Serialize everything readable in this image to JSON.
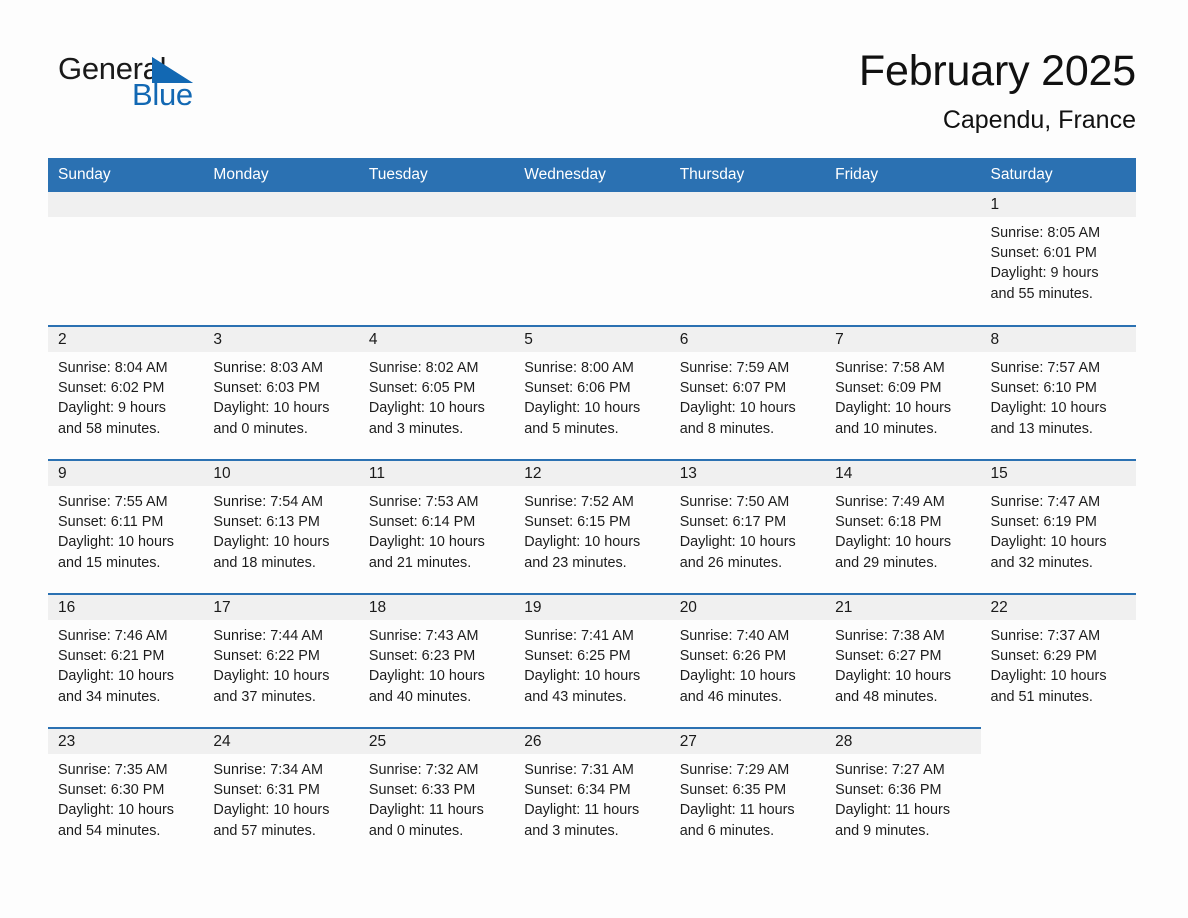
{
  "brand": {
    "name_part1": "General",
    "name_part2": "Blue",
    "accent_color": "#1268b3",
    "logo_icon": "triangle-flag-icon"
  },
  "header": {
    "month_title": "February 2025",
    "location": "Capendu, France"
  },
  "theme": {
    "header_blue": "#2b71b2",
    "row_rule_blue": "#2b71b2",
    "daynum_band": "#f0f0f0",
    "page_background": "#fdfdfd",
    "text": "#1d1d1d"
  },
  "weekday_headers": [
    "Sunday",
    "Monday",
    "Tuesday",
    "Wednesday",
    "Thursday",
    "Friday",
    "Saturday"
  ],
  "labels": {
    "sunrise_prefix": "Sunrise:",
    "sunset_prefix": "Sunset:",
    "daylight_prefix": "Daylight:"
  },
  "weeks": [
    [
      {
        "day": "",
        "blank": true
      },
      {
        "day": "",
        "blank": true
      },
      {
        "day": "",
        "blank": true
      },
      {
        "day": "",
        "blank": true
      },
      {
        "day": "",
        "blank": true
      },
      {
        "day": "",
        "blank": true
      },
      {
        "day": "1",
        "sunrise": "Sunrise: 8:05 AM",
        "sunset": "Sunset: 6:01 PM",
        "daylight_line1": "Daylight: 9 hours",
        "daylight_line2": "and 55 minutes."
      }
    ],
    [
      {
        "day": "2",
        "sunrise": "Sunrise: 8:04 AM",
        "sunset": "Sunset: 6:02 PM",
        "daylight_line1": "Daylight: 9 hours",
        "daylight_line2": "and 58 minutes."
      },
      {
        "day": "3",
        "sunrise": "Sunrise: 8:03 AM",
        "sunset": "Sunset: 6:03 PM",
        "daylight_line1": "Daylight: 10 hours",
        "daylight_line2": "and 0 minutes."
      },
      {
        "day": "4",
        "sunrise": "Sunrise: 8:02 AM",
        "sunset": "Sunset: 6:05 PM",
        "daylight_line1": "Daylight: 10 hours",
        "daylight_line2": "and 3 minutes."
      },
      {
        "day": "5",
        "sunrise": "Sunrise: 8:00 AM",
        "sunset": "Sunset: 6:06 PM",
        "daylight_line1": "Daylight: 10 hours",
        "daylight_line2": "and 5 minutes."
      },
      {
        "day": "6",
        "sunrise": "Sunrise: 7:59 AM",
        "sunset": "Sunset: 6:07 PM",
        "daylight_line1": "Daylight: 10 hours",
        "daylight_line2": "and 8 minutes."
      },
      {
        "day": "7",
        "sunrise": "Sunrise: 7:58 AM",
        "sunset": "Sunset: 6:09 PM",
        "daylight_line1": "Daylight: 10 hours",
        "daylight_line2": "and 10 minutes."
      },
      {
        "day": "8",
        "sunrise": "Sunrise: 7:57 AM",
        "sunset": "Sunset: 6:10 PM",
        "daylight_line1": "Daylight: 10 hours",
        "daylight_line2": "and 13 minutes."
      }
    ],
    [
      {
        "day": "9",
        "sunrise": "Sunrise: 7:55 AM",
        "sunset": "Sunset: 6:11 PM",
        "daylight_line1": "Daylight: 10 hours",
        "daylight_line2": "and 15 minutes."
      },
      {
        "day": "10",
        "sunrise": "Sunrise: 7:54 AM",
        "sunset": "Sunset: 6:13 PM",
        "daylight_line1": "Daylight: 10 hours",
        "daylight_line2": "and 18 minutes."
      },
      {
        "day": "11",
        "sunrise": "Sunrise: 7:53 AM",
        "sunset": "Sunset: 6:14 PM",
        "daylight_line1": "Daylight: 10 hours",
        "daylight_line2": "and 21 minutes."
      },
      {
        "day": "12",
        "sunrise": "Sunrise: 7:52 AM",
        "sunset": "Sunset: 6:15 PM",
        "daylight_line1": "Daylight: 10 hours",
        "daylight_line2": "and 23 minutes."
      },
      {
        "day": "13",
        "sunrise": "Sunrise: 7:50 AM",
        "sunset": "Sunset: 6:17 PM",
        "daylight_line1": "Daylight: 10 hours",
        "daylight_line2": "and 26 minutes."
      },
      {
        "day": "14",
        "sunrise": "Sunrise: 7:49 AM",
        "sunset": "Sunset: 6:18 PM",
        "daylight_line1": "Daylight: 10 hours",
        "daylight_line2": "and 29 minutes."
      },
      {
        "day": "15",
        "sunrise": "Sunrise: 7:47 AM",
        "sunset": "Sunset: 6:19 PM",
        "daylight_line1": "Daylight: 10 hours",
        "daylight_line2": "and 32 minutes."
      }
    ],
    [
      {
        "day": "16",
        "sunrise": "Sunrise: 7:46 AM",
        "sunset": "Sunset: 6:21 PM",
        "daylight_line1": "Daylight: 10 hours",
        "daylight_line2": "and 34 minutes."
      },
      {
        "day": "17",
        "sunrise": "Sunrise: 7:44 AM",
        "sunset": "Sunset: 6:22 PM",
        "daylight_line1": "Daylight: 10 hours",
        "daylight_line2": "and 37 minutes."
      },
      {
        "day": "18",
        "sunrise": "Sunrise: 7:43 AM",
        "sunset": "Sunset: 6:23 PM",
        "daylight_line1": "Daylight: 10 hours",
        "daylight_line2": "and 40 minutes."
      },
      {
        "day": "19",
        "sunrise": "Sunrise: 7:41 AM",
        "sunset": "Sunset: 6:25 PM",
        "daylight_line1": "Daylight: 10 hours",
        "daylight_line2": "and 43 minutes."
      },
      {
        "day": "20",
        "sunrise": "Sunrise: 7:40 AM",
        "sunset": "Sunset: 6:26 PM",
        "daylight_line1": "Daylight: 10 hours",
        "daylight_line2": "and 46 minutes."
      },
      {
        "day": "21",
        "sunrise": "Sunrise: 7:38 AM",
        "sunset": "Sunset: 6:27 PM",
        "daylight_line1": "Daylight: 10 hours",
        "daylight_line2": "and 48 minutes."
      },
      {
        "day": "22",
        "sunrise": "Sunrise: 7:37 AM",
        "sunset": "Sunset: 6:29 PM",
        "daylight_line1": "Daylight: 10 hours",
        "daylight_line2": "and 51 minutes."
      }
    ],
    [
      {
        "day": "23",
        "sunrise": "Sunrise: 7:35 AM",
        "sunset": "Sunset: 6:30 PM",
        "daylight_line1": "Daylight: 10 hours",
        "daylight_line2": "and 54 minutes."
      },
      {
        "day": "24",
        "sunrise": "Sunrise: 7:34 AM",
        "sunset": "Sunset: 6:31 PM",
        "daylight_line1": "Daylight: 10 hours",
        "daylight_line2": "and 57 minutes."
      },
      {
        "day": "25",
        "sunrise": "Sunrise: 7:32 AM",
        "sunset": "Sunset: 6:33 PM",
        "daylight_line1": "Daylight: 11 hours",
        "daylight_line2": "and 0 minutes."
      },
      {
        "day": "26",
        "sunrise": "Sunrise: 7:31 AM",
        "sunset": "Sunset: 6:34 PM",
        "daylight_line1": "Daylight: 11 hours",
        "daylight_line2": "and 3 minutes."
      },
      {
        "day": "27",
        "sunrise": "Sunrise: 7:29 AM",
        "sunset": "Sunset: 6:35 PM",
        "daylight_line1": "Daylight: 11 hours",
        "daylight_line2": "and 6 minutes."
      },
      {
        "day": "28",
        "sunrise": "Sunrise: 7:27 AM",
        "sunset": "Sunset: 6:36 PM",
        "daylight_line1": "Daylight: 11 hours",
        "daylight_line2": "and 9 minutes."
      },
      {
        "day": "",
        "blank": true
      }
    ]
  ]
}
